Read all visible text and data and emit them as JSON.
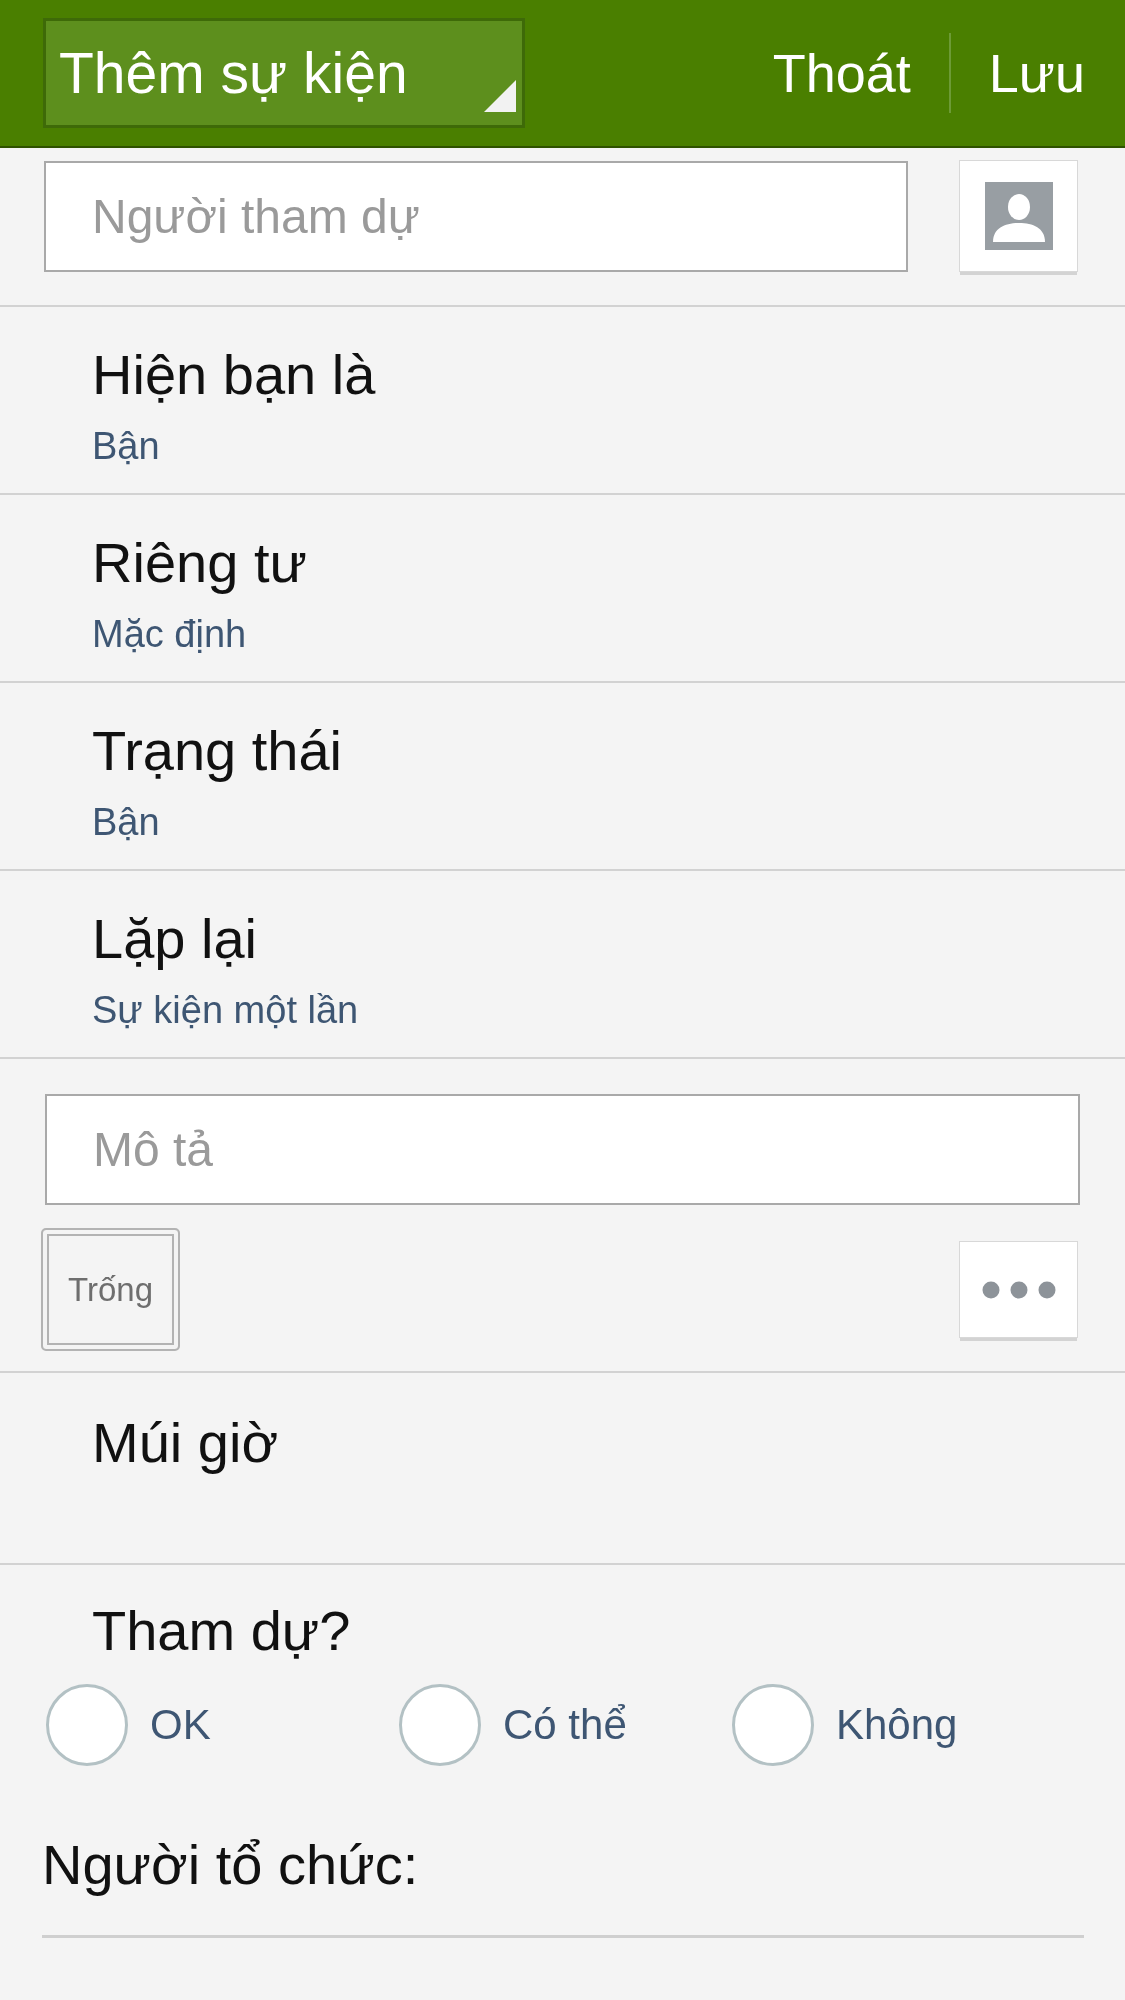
{
  "header": {
    "title": "Thêm sự kiện",
    "actions": [
      "Thoát",
      "Lưu"
    ]
  },
  "attendees": {
    "placeholder": "Người tham dự"
  },
  "settings": [
    {
      "label": "Hiện bạn là",
      "value": "Bận"
    },
    {
      "label": "Riêng tư",
      "value": "Mặc định"
    },
    {
      "label": "Trạng thái",
      "value": "Bận"
    },
    {
      "label": "Lặp lại",
      "value": "Sự kiện một lần"
    }
  ],
  "description": {
    "placeholder": "Mô tả"
  },
  "free_button": "Trống",
  "timezone": {
    "label": "Múi giờ"
  },
  "attendance": {
    "label": "Tham dự?",
    "options": [
      {
        "label": "OK",
        "selected": false
      },
      {
        "label": "Có thể",
        "selected": false
      },
      {
        "label": "Không",
        "selected": false
      }
    ]
  },
  "organizer": {
    "label": "Người tổ chức:"
  }
}
